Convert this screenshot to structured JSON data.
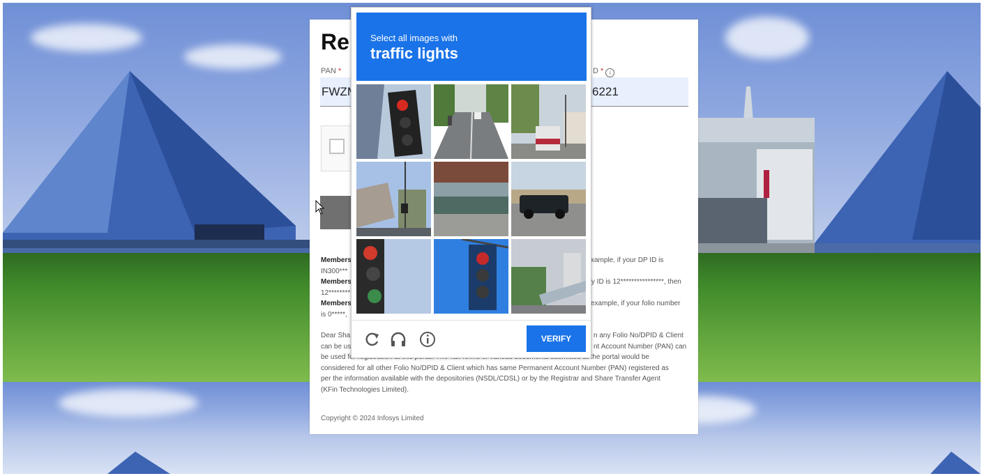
{
  "page": {
    "title": "Re",
    "pan_label": "PAN",
    "pan_value": "FWZM",
    "dp_label": "D",
    "dp_value": "6221",
    "required_mark": "*",
    "info": [
      {
        "bold": "Members",
        "text": "xample, if your DP ID is"
      },
      {
        "bold": "",
        "text": "IN300***"
      },
      {
        "bold": "Members",
        "text": "ary ID is 12****************, then"
      },
      {
        "bold": "",
        "text": "12********"
      },
      {
        "bold": "Members",
        "text": "example, if your folio number"
      },
      {
        "bold": "",
        "text": "is 0*****,"
      }
    ],
    "notice_left_1": "Dear Sha",
    "notice_left_2": "can be us",
    "notice_right_1": "n any Folio No/DPID & Client",
    "notice_right_2": "nt Account Number (PAN) can",
    "notice_lines": [
      "be used for registration at this portal. The Tax forms or various documents submitted at the portal would be",
      "considered for all other Folio No/DPID & Client which has same Permanent Account Number (PAN) registered as",
      "per the information available with the depositories (NSDL/CDSL) or by the Registrar and Share Transfer Agent",
      "(KFin Technologies Limited)."
    ],
    "copyright": "Copyright © 2024 Infosys Limited"
  },
  "captcha": {
    "instruction": "Select all images with",
    "target": "traffic lights",
    "verify_label": "VERIFY",
    "tiles": [
      {
        "name": "captcha-tile-1",
        "content": "traffic-light-closeup"
      },
      {
        "name": "captcha-tile-2",
        "content": "road-with-vehicles"
      },
      {
        "name": "captcha-tile-3",
        "content": "street-with-bus"
      },
      {
        "name": "captcha-tile-4",
        "content": "building-with-signal"
      },
      {
        "name": "captcha-tile-5",
        "content": "overpass"
      },
      {
        "name": "captcha-tile-6",
        "content": "pickup-truck"
      },
      {
        "name": "captcha-tile-7",
        "content": "traffic-light-side"
      },
      {
        "name": "captcha-tile-8",
        "content": "traffic-light-blue-sky"
      },
      {
        "name": "captcha-tile-9",
        "content": "city-overpass"
      }
    ],
    "icons": [
      "reload-icon",
      "headphones-icon",
      "info-icon"
    ]
  },
  "colors": {
    "accent": "#1a73e8",
    "field_bg": "#e8f0fe",
    "required": "#d32f2f"
  }
}
